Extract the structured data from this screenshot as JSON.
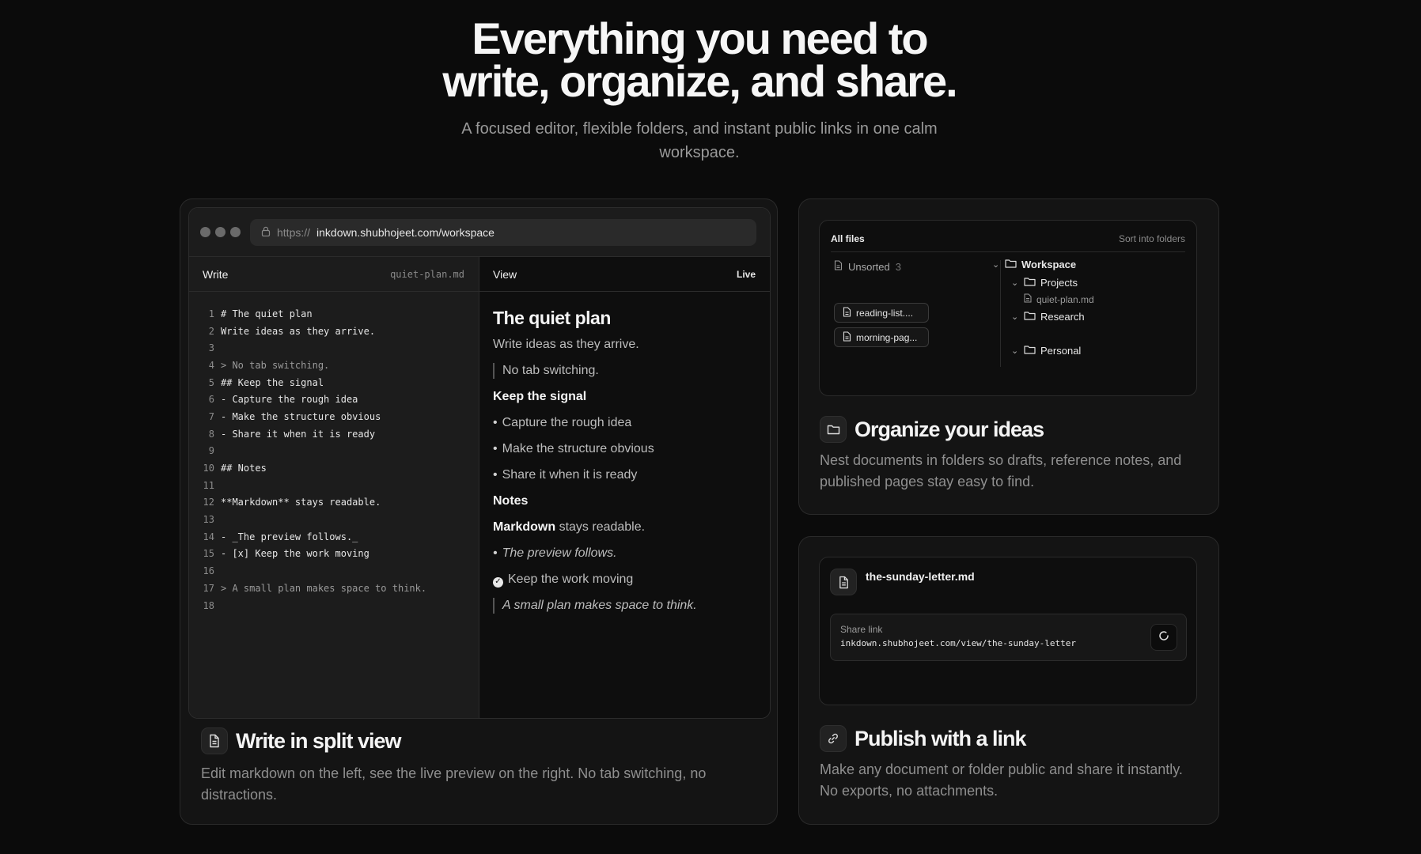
{
  "hero": {
    "title_line1": "Everything you need to",
    "title_line2": "write, organize, and share.",
    "subtitle": "A focused editor, flexible folders, and instant public links in one calm workspace."
  },
  "browser": {
    "url_protocol": "https://",
    "url_host": "inkdown.shubhojeet.com/workspace"
  },
  "editor": {
    "write_label": "Write",
    "filename": "quiet-plan.md",
    "view_label": "View",
    "live_label": "Live",
    "lines": [
      {
        "n": "1",
        "text": "# The quiet plan",
        "muted": false
      },
      {
        "n": "2",
        "text": "Write ideas as they arrive.",
        "muted": false
      },
      {
        "n": "3",
        "text": "",
        "muted": false
      },
      {
        "n": "4",
        "text": "> No tab switching.",
        "muted": true
      },
      {
        "n": "5",
        "text": "## Keep the signal",
        "muted": false
      },
      {
        "n": "6",
        "text": "- Capture the rough idea",
        "muted": false
      },
      {
        "n": "7",
        "text": "- Make the structure obvious",
        "muted": false
      },
      {
        "n": "8",
        "text": "- Share it when it is ready",
        "muted": false
      },
      {
        "n": "9",
        "text": "",
        "muted": false
      },
      {
        "n": "10",
        "text": "## Notes",
        "muted": false
      },
      {
        "n": "11",
        "text": "",
        "muted": false
      },
      {
        "n": "12",
        "text": "**Markdown** stays readable.",
        "muted": false
      },
      {
        "n": "13",
        "text": "",
        "muted": false
      },
      {
        "n": "14",
        "text": "- _The preview follows._",
        "muted": false
      },
      {
        "n": "15",
        "text": "- [x] Keep the work moving",
        "muted": false
      },
      {
        "n": "16",
        "text": "",
        "muted": false
      },
      {
        "n": "17",
        "text": "> A small plan makes space to think.",
        "muted": true
      },
      {
        "n": "18",
        "text": "",
        "muted": false
      }
    ],
    "preview": {
      "h1": "The quiet plan",
      "p1": "Write ideas as they arrive.",
      "quote1": "No tab switching.",
      "h2a": "Keep the signal",
      "b1": "Capture the rough idea",
      "b2": "Make the structure obvious",
      "b3": "Share it when it is ready",
      "h2b": "Notes",
      "bold": "Markdown",
      "bold_rest": " stays readable.",
      "italic_item": "The preview follows.",
      "task": "Keep the work moving",
      "quote2": "A small plan makes space to think."
    }
  },
  "card_write": {
    "title": "Write in split view",
    "description": "Edit markdown on the left, see the live preview on the right. No tab switching, no distractions."
  },
  "files": {
    "all_files": "All files",
    "sort_label": "Sort into folders",
    "unsorted_label": "Unsorted",
    "unsorted_count": "3",
    "chip1": "reading-list....",
    "chip2": "morning-pag...",
    "workspace": "Workspace",
    "projects": "Projects",
    "quiet_plan": "quiet-plan.md",
    "research": "Research",
    "personal": "Personal"
  },
  "card_organize": {
    "title": "Organize your ideas",
    "description": "Nest documents in folders so drafts, reference notes, and published pages stay easy to find."
  },
  "share": {
    "filename": "the-sunday-letter.md",
    "share_label": "Share link",
    "share_url": "inkdown.shubhojeet.com/view/the-sunday-letter"
  },
  "card_publish": {
    "title": "Publish with a link",
    "description": "Make any document or folder public and share it instantly. No exports, no attachments."
  }
}
